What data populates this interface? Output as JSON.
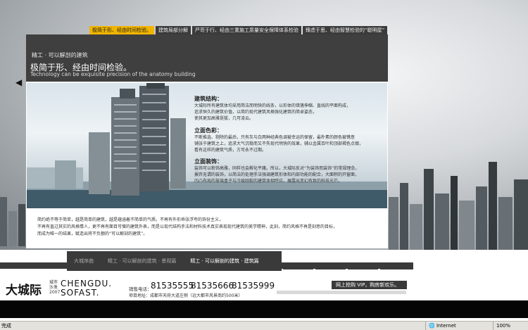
{
  "tabs": [
    {
      "label": "极简于形、经由时间检验。",
      "active": true
    },
    {
      "label": "建筑局部分解",
      "active": false
    },
    {
      "label": "严苛于行、经由三重施工质量安全保障体系检验",
      "active": false
    },
    {
      "label": "臻虑于思、经由智慧检验的“聪明屋”",
      "active": false
    }
  ],
  "panel": {
    "subtitle": "精工 · 可以解剖的建筑",
    "title": "极简于形、经由时间检验。",
    "title_en": "Technology can be exquisite precision of the anatomy building"
  },
  "sections": [
    {
      "heading": "建筑结构：",
      "lines": [
        "大城际所有建筑体均采用简洁而明快的线条，以形体的错落伸缩、直线的平面构成，",
        "追求恒久的建筑价值，以简约现代建筑风格强化建筑的简卓姿态，",
        "使其更加高雅挺拔，几可凌云。"
      ]
    },
    {
      "heading": "立面色彩：",
      "lines": [
        "不断推选、剔除的最后，只有灰与白两种经典色调被幸运的保留，最朴素的颜色被镌意",
        "铺张于建筑之上，追求大气沉稳而又不失现代明快的效果，辅以金属百叶和顶部褐色点缀，",
        "看有这样的建筑气质，方可永不过期。"
      ]
    },
    {
      "heading": "立面装饰：",
      "lines": [
        "装饰可以粉饰高雅，同样也会孵化平庸。所以，大城际反对“为装饰而装饰”的常规理念，",
        "摒弃无谓的装饰，以简洁的处理手法强调建筑形体和内部功能的配合，大面积的开窗面，",
        "凹凸布局的玻璃盒子与冷峻刚毅的建筑体相呼应，展露出变幻有致的科技光芒。"
      ]
    }
  ],
  "footer_text": [
    "简约绝不等于简单，越是简单的建筑，越是蕴涵着不简单的气质。不再有外形乖张浮夸的饰份主义，",
    "不再有直过其实的风格情人，更不再有面目可憎的建筑外表，而是以现代结构手法和材料技术真实表现现代建筑的美学精神，此刻，简约风格不再是刻意的目标，",
    "而成为唯一的结果，赋造出将不负额的“可以解剖的建筑”。"
  ],
  "bottom_nav": [
    {
      "label": "大城序曲",
      "active": false
    },
    {
      "label": "精工 · 可以解剖的建筑 · 景观篇",
      "active": false
    },
    {
      "label": "精工 · 可以解剖的建筑 · 建筑篇",
      "active": true
    }
  ],
  "brand": {
    "name_cn": "大城际",
    "tagline_cn": "城市沙发2007",
    "name_en_1": "CHENGDU.",
    "name_en_2": "SOFAST."
  },
  "contact": {
    "tel_label": "销售电话：",
    "phones": [
      "81535555",
      "81535666",
      "81535999"
    ],
    "address": "项目地址：成都市天府大道左侧（远大都市风景南约500米）"
  },
  "vip_label": "网上抢购 VIP，购房新欢乐。",
  "statusbar": {
    "done": "完成",
    "zone": "Internet",
    "zoom": "100%"
  },
  "colors": {
    "accent": "#f0b400",
    "panel_dark": "#3f3f3f"
  }
}
